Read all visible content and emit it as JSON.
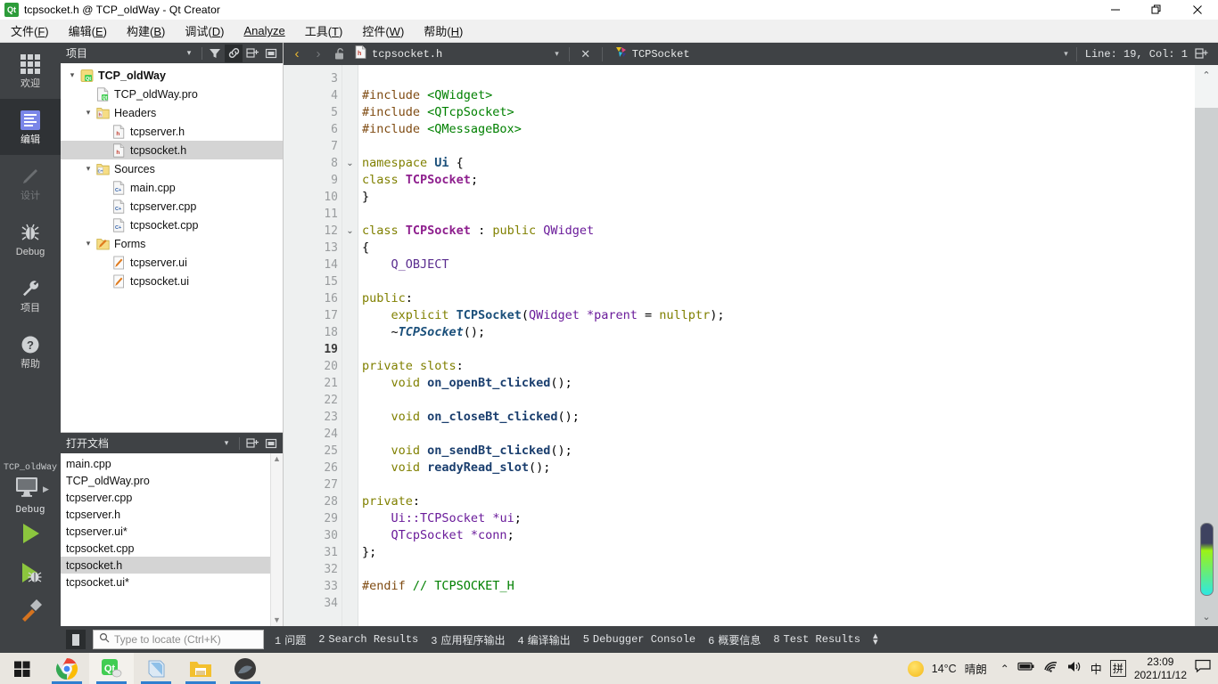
{
  "window": {
    "title": "tcpsocket.h @ TCP_oldWay - Qt Creator",
    "app_icon": "qt-logo-icon",
    "minimize": "—",
    "maximize": "❐",
    "close": "✕"
  },
  "menubar": {
    "items": [
      {
        "label": "文件(F)",
        "name": "menu-file"
      },
      {
        "label": "编辑(E)",
        "name": "menu-edit"
      },
      {
        "label": "构建(B)",
        "name": "menu-build"
      },
      {
        "label": "调试(D)",
        "name": "menu-debug"
      },
      {
        "label": "Analyze",
        "name": "menu-analyze"
      },
      {
        "label": "工具(T)",
        "name": "menu-tools"
      },
      {
        "label": "控件(W)",
        "name": "menu-window"
      },
      {
        "label": "帮助(H)",
        "name": "menu-help"
      }
    ]
  },
  "modebar": {
    "modes": [
      {
        "label": "欢迎",
        "icon": "grid-icon",
        "state": "normal"
      },
      {
        "label": "编辑",
        "icon": "document-icon",
        "state": "active"
      },
      {
        "label": "设计",
        "icon": "pencil-icon",
        "state": "disabled"
      },
      {
        "label": "Debug",
        "icon": "bug-icon",
        "state": "normal"
      },
      {
        "label": "项目",
        "icon": "wrench-icon",
        "state": "normal"
      },
      {
        "label": "帮助",
        "icon": "question-circle-icon",
        "state": "normal"
      }
    ],
    "kit": {
      "project": "TCP_oldWay",
      "build_config": "Debug",
      "target_icon": "monitor-icon",
      "run_icon": "play-icon",
      "debug_icon": "play-bug-icon",
      "build_icon": "hammer-icon"
    }
  },
  "project_panel": {
    "title": "项目",
    "tools": [
      {
        "name": "view-dropdown",
        "glyph": "▾"
      },
      {
        "name": "filter-icon",
        "glyph": "filter"
      },
      {
        "name": "sync-with-editor-icon",
        "glyph": "link",
        "active": true
      },
      {
        "name": "split-icon",
        "glyph": "split"
      },
      {
        "name": "close-panel-icon",
        "glyph": "minimize"
      }
    ],
    "tree": [
      {
        "label": "TCP_oldWay",
        "indent": 0,
        "arrow": "▾",
        "icon": "qt-project-icon",
        "bold": true,
        "selected": false
      },
      {
        "label": "TCP_oldWay.pro",
        "indent": 1,
        "arrow": "",
        "icon": "pro-file-icon",
        "bold": false,
        "selected": false
      },
      {
        "label": "Headers",
        "indent": 1,
        "arrow": "▾",
        "icon": "headers-folder-icon",
        "bold": false,
        "selected": false
      },
      {
        "label": "tcpserver.h",
        "indent": 2,
        "arrow": "",
        "icon": "h-file-icon",
        "bold": false,
        "selected": false
      },
      {
        "label": "tcpsocket.h",
        "indent": 2,
        "arrow": "",
        "icon": "h-file-icon",
        "bold": false,
        "selected": true
      },
      {
        "label": "Sources",
        "indent": 1,
        "arrow": "▾",
        "icon": "sources-folder-icon",
        "bold": false,
        "selected": false
      },
      {
        "label": "main.cpp",
        "indent": 2,
        "arrow": "",
        "icon": "cpp-file-icon",
        "bold": false,
        "selected": false
      },
      {
        "label": "tcpserver.cpp",
        "indent": 2,
        "arrow": "",
        "icon": "cpp-file-icon",
        "bold": false,
        "selected": false
      },
      {
        "label": "tcpsocket.cpp",
        "indent": 2,
        "arrow": "",
        "icon": "cpp-file-icon",
        "bold": false,
        "selected": false
      },
      {
        "label": "Forms",
        "indent": 1,
        "arrow": "▾",
        "icon": "forms-folder-icon",
        "bold": false,
        "selected": false
      },
      {
        "label": "tcpserver.ui",
        "indent": 2,
        "arrow": "",
        "icon": "ui-file-icon",
        "bold": false,
        "selected": false
      },
      {
        "label": "tcpsocket.ui",
        "indent": 2,
        "arrow": "",
        "icon": "ui-file-icon",
        "bold": false,
        "selected": false
      }
    ]
  },
  "open_documents": {
    "title": "打开文档",
    "tools": [
      {
        "name": "view-dropdown",
        "glyph": "▾"
      },
      {
        "name": "split-icon",
        "glyph": "split"
      },
      {
        "name": "close-panel-icon",
        "glyph": "minimize"
      }
    ],
    "items": [
      {
        "label": "main.cpp",
        "selected": false
      },
      {
        "label": "TCP_oldWay.pro",
        "selected": false
      },
      {
        "label": "tcpserver.cpp",
        "selected": false
      },
      {
        "label": "tcpserver.h",
        "selected": false
      },
      {
        "label": "tcpserver.ui*",
        "selected": false
      },
      {
        "label": "tcpsocket.cpp",
        "selected": false
      },
      {
        "label": "tcpsocket.h",
        "selected": true
      },
      {
        "label": "tcpsocket.ui*",
        "selected": false
      }
    ],
    "scroll_up": "▲",
    "scroll_down": "▼"
  },
  "editor": {
    "toolbar": {
      "back_icon": "back-arrow-icon",
      "forward_icon": "forward-arrow-icon",
      "lock_icon": "unlocked-padlock-icon",
      "file_icon": "h-file-icon",
      "filename": "tcpsocket.h",
      "dropdown_glyph": "▾",
      "close_glyph": "✕",
      "symbol_icon": "qt-class-icon",
      "symbol": "TCPSocket",
      "right_dropdown_glyph": "▾",
      "line_col": "Line: 19, Col: 1",
      "split_icon": "split-editor-icon"
    },
    "first_line_number": 3,
    "current_line": 19,
    "fold_markers": [
      8,
      12
    ],
    "lines": [
      {
        "n": 3,
        "tokens": []
      },
      {
        "n": 4,
        "tokens": [
          {
            "t": "#include ",
            "c": "k-pre"
          },
          {
            "t": "<QWidget>",
            "c": "k-str"
          }
        ]
      },
      {
        "n": 5,
        "tokens": [
          {
            "t": "#include ",
            "c": "k-pre"
          },
          {
            "t": "<QTcpSocket>",
            "c": "k-str"
          }
        ]
      },
      {
        "n": 6,
        "tokens": [
          {
            "t": "#include ",
            "c": "k-pre"
          },
          {
            "t": "<QMessageBox>",
            "c": "k-str"
          }
        ]
      },
      {
        "n": 7,
        "tokens": []
      },
      {
        "n": 8,
        "tokens": [
          {
            "t": "namespace ",
            "c": "k-kw"
          },
          {
            "t": "Ui",
            "c": "k-cls2"
          },
          {
            "t": " {",
            "c": "k-op"
          }
        ]
      },
      {
        "n": 9,
        "tokens": [
          {
            "t": "class ",
            "c": "k-kw"
          },
          {
            "t": "TCPSocket",
            "c": "k-cls"
          },
          {
            "t": ";",
            "c": "k-op"
          }
        ]
      },
      {
        "n": 10,
        "tokens": [
          {
            "t": "}",
            "c": "k-op"
          }
        ]
      },
      {
        "n": 11,
        "tokens": []
      },
      {
        "n": 12,
        "tokens": [
          {
            "t": "class ",
            "c": "k-kw"
          },
          {
            "t": "TCPSocket",
            "c": "k-cls"
          },
          {
            "t": " : ",
            "c": "k-op"
          },
          {
            "t": "public ",
            "c": "k-kw"
          },
          {
            "t": "QWidget",
            "c": "k-type"
          }
        ]
      },
      {
        "n": 13,
        "tokens": [
          {
            "t": "{",
            "c": "k-op"
          }
        ]
      },
      {
        "n": 14,
        "tokens": [
          {
            "t": "    Q_OBJECT",
            "c": "k-macro"
          }
        ]
      },
      {
        "n": 15,
        "tokens": []
      },
      {
        "n": 16,
        "tokens": [
          {
            "t": "public",
            "c": "k-kw"
          },
          {
            "t": ":",
            "c": "k-op"
          }
        ]
      },
      {
        "n": 17,
        "tokens": [
          {
            "t": "    ",
            "c": "k-op"
          },
          {
            "t": "explicit ",
            "c": "k-kw"
          },
          {
            "t": "TCPSocket",
            "c": "k-cls2"
          },
          {
            "t": "(",
            "c": "k-op"
          },
          {
            "t": "QWidget ",
            "c": "k-type"
          },
          {
            "t": "*parent",
            "c": "k-var"
          },
          {
            "t": " = ",
            "c": "k-op"
          },
          {
            "t": "nullptr",
            "c": "k-kw"
          },
          {
            "t": ");",
            "c": "k-op"
          }
        ]
      },
      {
        "n": 18,
        "tokens": [
          {
            "t": "    ~",
            "c": "k-op"
          },
          {
            "t": "TCPSocket",
            "c": "k-dtor"
          },
          {
            "t": "();",
            "c": "k-op"
          }
        ]
      },
      {
        "n": 19,
        "tokens": []
      },
      {
        "n": 20,
        "tokens": [
          {
            "t": "private slots",
            "c": "k-kw"
          },
          {
            "t": ":",
            "c": "k-op"
          }
        ]
      },
      {
        "n": 21,
        "tokens": [
          {
            "t": "    ",
            "c": "k-op"
          },
          {
            "t": "void ",
            "c": "k-kw"
          },
          {
            "t": "on_openBt_clicked",
            "c": "k-fn"
          },
          {
            "t": "();",
            "c": "k-op"
          }
        ]
      },
      {
        "n": 22,
        "tokens": []
      },
      {
        "n": 23,
        "tokens": [
          {
            "t": "    ",
            "c": "k-op"
          },
          {
            "t": "void ",
            "c": "k-kw"
          },
          {
            "t": "on_closeBt_clicked",
            "c": "k-fn"
          },
          {
            "t": "();",
            "c": "k-op"
          }
        ]
      },
      {
        "n": 24,
        "tokens": []
      },
      {
        "n": 25,
        "tokens": [
          {
            "t": "    ",
            "c": "k-op"
          },
          {
            "t": "void ",
            "c": "k-kw"
          },
          {
            "t": "on_sendBt_clicked",
            "c": "k-fn"
          },
          {
            "t": "();",
            "c": "k-op"
          }
        ]
      },
      {
        "n": 26,
        "tokens": [
          {
            "t": "    ",
            "c": "k-op"
          },
          {
            "t": "void ",
            "c": "k-kw"
          },
          {
            "t": "readyRead_slot",
            "c": "k-fn"
          },
          {
            "t": "();",
            "c": "k-op"
          }
        ]
      },
      {
        "n": 27,
        "tokens": []
      },
      {
        "n": 28,
        "tokens": [
          {
            "t": "private",
            "c": "k-kw"
          },
          {
            "t": ":",
            "c": "k-op"
          }
        ]
      },
      {
        "n": 29,
        "tokens": [
          {
            "t": "    ",
            "c": "k-op"
          },
          {
            "t": "Ui::TCPSocket ",
            "c": "k-type"
          },
          {
            "t": "*ui",
            "c": "k-var"
          },
          {
            "t": ";",
            "c": "k-op"
          }
        ]
      },
      {
        "n": 30,
        "tokens": [
          {
            "t": "    ",
            "c": "k-op"
          },
          {
            "t": "QTcpSocket ",
            "c": "k-type"
          },
          {
            "t": "*conn",
            "c": "k-var"
          },
          {
            "t": ";",
            "c": "k-op"
          }
        ]
      },
      {
        "n": 31,
        "tokens": [
          {
            "t": "};",
            "c": "k-op"
          }
        ]
      },
      {
        "n": 32,
        "tokens": []
      },
      {
        "n": 33,
        "tokens": [
          {
            "t": "#endif ",
            "c": "k-pre"
          },
          {
            "t": "// TCPSOCKET_H",
            "c": "k-cm"
          }
        ]
      },
      {
        "n": 34,
        "tokens": []
      }
    ]
  },
  "statusbar": {
    "toggle_sidebar_icon": "toggle-output-pane-icon",
    "locator": {
      "icon": "search-icon",
      "placeholder": "Type to locate (Ctrl+K)",
      "value": ""
    },
    "output_tabs": [
      {
        "num": "1",
        "label": "问题"
      },
      {
        "num": "2",
        "label": "Search Results"
      },
      {
        "num": "3",
        "label": "应用程序输出"
      },
      {
        "num": "4",
        "label": "编译输出"
      },
      {
        "num": "5",
        "label": "Debugger Console"
      },
      {
        "num": "6",
        "label": "概要信息"
      },
      {
        "num": "8",
        "label": "Test Results"
      }
    ],
    "updown_glyph": "⬍"
  },
  "taskbar": {
    "items": [
      {
        "name": "start-button-icon",
        "active": false,
        "running": false
      },
      {
        "name": "chrome-icon",
        "active": false,
        "running": true
      },
      {
        "name": "qt-creator-icon",
        "active": true,
        "running": true
      },
      {
        "name": "notepad-icon",
        "active": false,
        "running": true
      },
      {
        "name": "file-explorer-icon",
        "active": false,
        "running": true
      },
      {
        "name": "media-app-icon",
        "active": false,
        "running": true
      }
    ],
    "tray": {
      "weather_icon": "sun-icon",
      "temperature": "14°C",
      "condition": "晴朗",
      "chevron": "⌃",
      "battery_icon": "battery-icon",
      "wifi_icon": "wifi-icon",
      "volume_icon": "volume-icon",
      "ime_lang": "中",
      "ime_mode": "拼",
      "time": "23:09",
      "date": "2021/11/12",
      "notifications_icon": "notification-icon"
    }
  }
}
